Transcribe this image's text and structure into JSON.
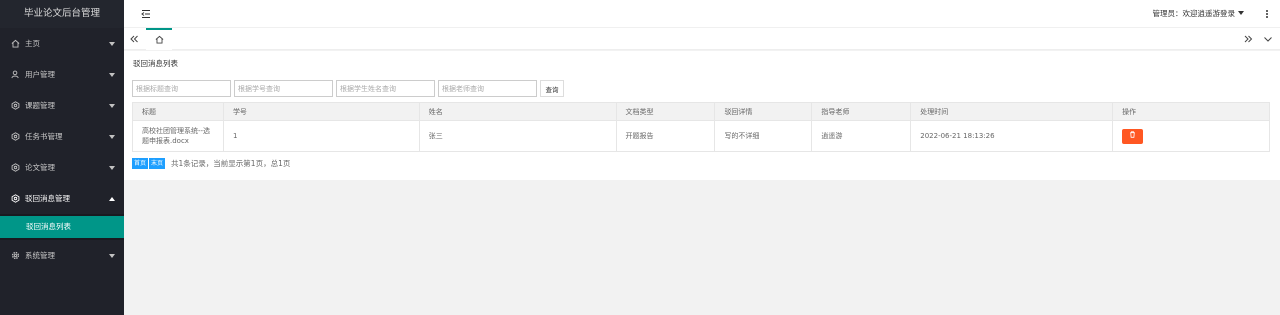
{
  "app": {
    "title": "毕业论文后台管理"
  },
  "sidebar": {
    "items": [
      {
        "label": "主页",
        "icon": "home-icon"
      },
      {
        "label": "用户管理",
        "icon": "user-icon"
      },
      {
        "label": "课题管理",
        "icon": "settings-icon"
      },
      {
        "label": "任务书管理",
        "icon": "settings-icon"
      },
      {
        "label": "论文管理",
        "icon": "settings-icon"
      },
      {
        "label": "驳回消息管理",
        "icon": "settings-icon",
        "expanded": true,
        "children": [
          {
            "label": "驳回消息列表",
            "active": true
          }
        ]
      },
      {
        "label": "系统管理",
        "icon": "gear-icon"
      }
    ]
  },
  "header": {
    "user_text": "管理员：欢迎逍遥游登录"
  },
  "page": {
    "title": "驳回消息列表",
    "search": {
      "title_placeholder": "根据标题查询",
      "student_no_placeholder": "根据学号查询",
      "student_name_placeholder": "根据学生姓名查询",
      "teacher_placeholder": "根据老师查询",
      "button_label": "查询"
    },
    "table": {
      "columns": [
        "标题",
        "学号",
        "姓名",
        "文档类型",
        "驳回详情",
        "指导老师",
        "处理时间",
        "操作"
      ],
      "rows": [
        {
          "title": "高校社团管理系统--选题申报表.docx",
          "student_no": "1",
          "name": "张三",
          "doc_type": "开题报告",
          "reject_detail": "写的不详细",
          "teacher": "逍遥游",
          "time": "2022-06-21 18:13:26"
        }
      ]
    },
    "pager": {
      "first_label": "首页",
      "last_label": "末页",
      "info": "共1条记录，当前显示第1页，总1页"
    }
  },
  "colors": {
    "sidebar_bg": "#20222a",
    "accent": "#009688",
    "danger": "#ff5722",
    "primary": "#1e9fff"
  }
}
